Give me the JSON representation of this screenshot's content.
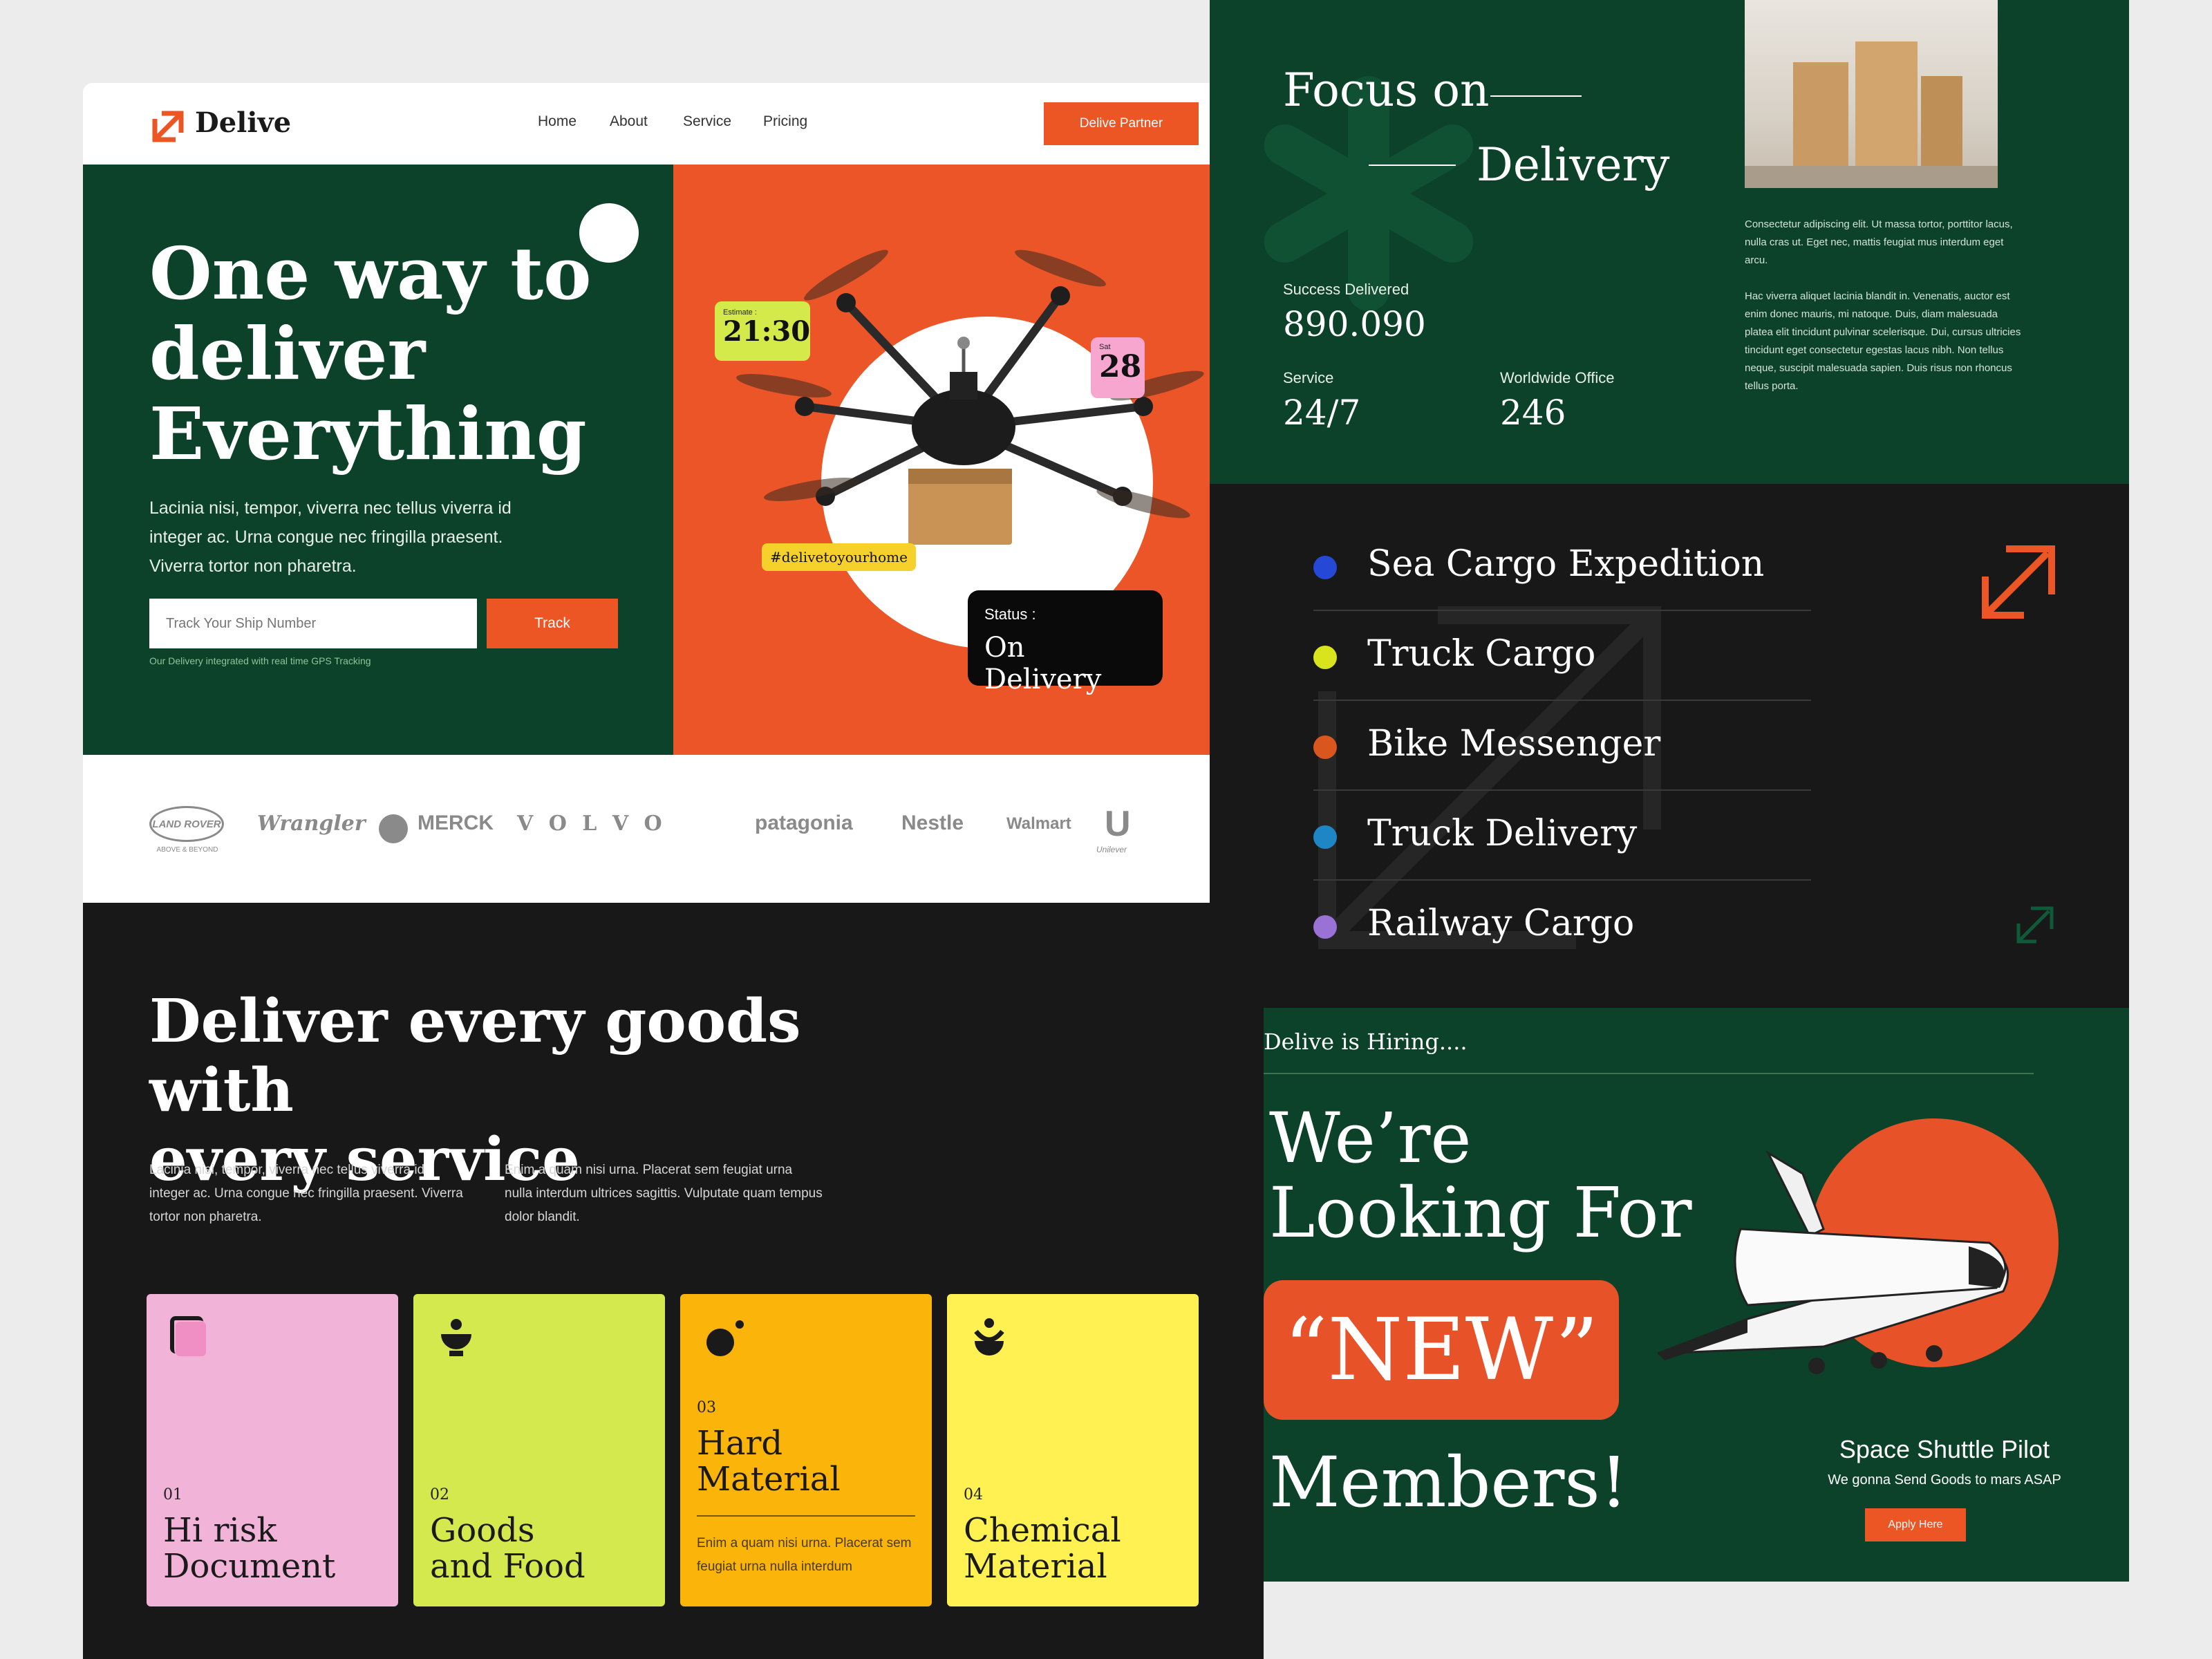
{
  "nav": {
    "logo": "Delive",
    "links": [
      "Home",
      "About",
      "Service",
      "Pricing"
    ],
    "cta": "Delive Partner"
  },
  "hero": {
    "title_lines": [
      "One way to",
      "deliver",
      "Everything"
    ],
    "description": "Lacinia nisi, tempor, viverra nec tellus viverra id integer ac. Urna congue nec fringilla praesent. Viverra tortor non pharetra.",
    "input_placeholder": "Track Your Ship Number",
    "track_button": "Track",
    "note": "Our Delivery integrated with real time GPS Tracking",
    "estimate_label": "Estimate :",
    "estimate_value": "21:30",
    "date_label": "Sat",
    "date_value": "28",
    "hashtag": "#delivetoyourhome",
    "status_label": "Status :",
    "status_value": "On Delivery"
  },
  "brands": {
    "land_rover": "LAND ROVER",
    "land_rover_tag": "ABOVE & BEYOND",
    "wrangler": "Wrangler",
    "merck": "MERCK",
    "volvo": "V O L V O",
    "patagonia": "patagonia",
    "nestle": "Nestle",
    "walmart": "Walmart",
    "unilever": "Unilever"
  },
  "services": {
    "title_lines": [
      "Deliver every goods with",
      "every service"
    ],
    "paragraph_left": "Lacinia nisi, tempor, viverra nec tellus viverra id integer ac. Urna congue nec fringilla praesent. Viverra tortor non pharetra.",
    "paragraph_right": "Enim a quam nisi urna. Placerat sem feugiat urna nulla interdum ultrices sagittis. Vulputate quam tempus dolor blandit.",
    "cards": [
      {
        "num": "01",
        "title_lines": [
          "Hi risk",
          "Document"
        ],
        "color": "#f2b3d9"
      },
      {
        "num": "02",
        "title_lines": [
          "Goods",
          "and Food"
        ],
        "color": "#d4e94e"
      },
      {
        "num": "03",
        "title_lines": [
          "Hard",
          "Material"
        ],
        "desc": "Enim a quam nisi urna. Placerat sem feugiat urna nulla interdum",
        "color": "#fbb50a"
      },
      {
        "num": "04",
        "title_lines": [
          "Chemical",
          "Material"
        ],
        "color": "#fef151"
      }
    ]
  },
  "focus": {
    "title_1": "Focus on",
    "title_2": "Delivery",
    "stats": [
      {
        "label": "Success Delivered",
        "value": "890.090"
      },
      {
        "label": "Service",
        "value": "24/7"
      },
      {
        "label": "Worldwide Office",
        "value": "246"
      }
    ],
    "paragraph_1": "Consectetur adipiscing elit. Ut massa tortor, porttitor lacus, nulla cras ut. Eget nec, mattis feugiat mus interdum eget arcu.",
    "paragraph_2": "Hac viverra aliquet lacinia blandit in. Venenatis, auctor est enim donec mauris, mi natoque. Duis, diam malesuada platea elit tincidunt pulvinar scelerisque. Dui, cursus ultricies tincidunt eget consectetur egestas lacus nibh. Non tellus neque, suscipit malesuada sapien. Duis risus non rhoncus tellus porta."
  },
  "cargo": {
    "items": [
      {
        "name": "Sea Cargo Expedition",
        "color": "#2648d6"
      },
      {
        "name": "Truck Cargo",
        "color": "#d9e41c"
      },
      {
        "name": "Bike Messenger",
        "color": "#d9571f"
      },
      {
        "name": "Truck Delivery",
        "color": "#1e86c4"
      },
      {
        "name": "Railway Cargo",
        "color": "#9a72d6"
      }
    ]
  },
  "hiring": {
    "label": "Delive is Hiring....",
    "line_1": "We’re",
    "line_2": "Looking For",
    "highlight": "“NEW”",
    "line_3": "Members!",
    "job_title": "Space Shuttle Pilot",
    "job_sub": "We gonna Send Goods to mars ASAP",
    "apply": "Apply Here"
  },
  "colors": {
    "green": "#0b4229",
    "orange": "#ec5524",
    "dark": "#181818"
  }
}
